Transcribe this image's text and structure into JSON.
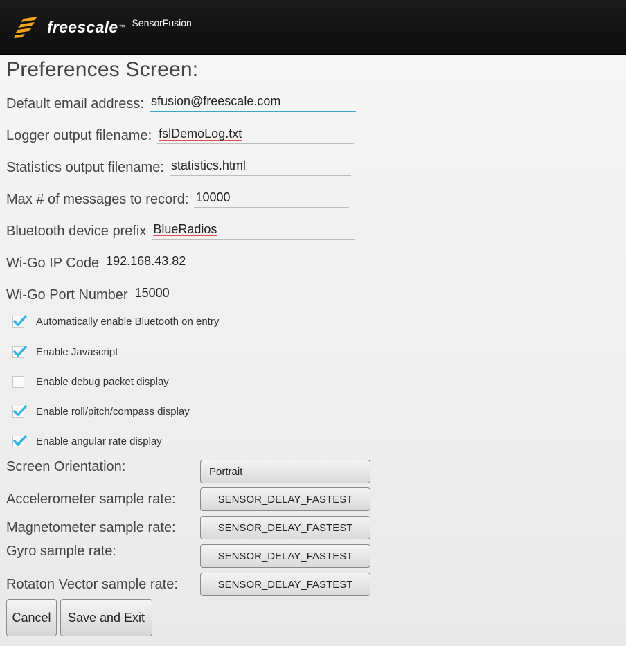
{
  "header": {
    "brand": "freescale",
    "trademark": "™",
    "app_name": "SensorFusion",
    "bar_color": "#111111",
    "logo_color": "#f2a51a"
  },
  "title": "Preferences Screen:",
  "fields": [
    {
      "label": "Default email address:",
      "value": "sfusion@freescale.com"
    },
    {
      "label": "Logger output filename:",
      "value": "fslDemoLog.txt"
    },
    {
      "label": "Statistics output filename:",
      "value": "statistics.html"
    },
    {
      "label": "Max # of messages to record:",
      "value": "10000"
    },
    {
      "label": "Bluetooth device prefix",
      "value": "BlueRadios"
    },
    {
      "label": "Wi-Go IP Code",
      "value": "192.168.43.82"
    },
    {
      "label": "Wi-Go Port Number",
      "value": "15000"
    }
  ],
  "checkboxes": [
    {
      "label": "Automatically enable Bluetooth on entry",
      "checked": true
    },
    {
      "label": "Enable Javascript",
      "checked": true
    },
    {
      "label": "Enable debug packet display",
      "checked": false
    },
    {
      "label": "Enable roll/pitch/compass display",
      "checked": true
    },
    {
      "label": "Enable angular rate display",
      "checked": true
    }
  ],
  "selects": [
    {
      "label": "Screen Orientation:",
      "value": "Portrait"
    },
    {
      "label": "Accelerometer sample rate:",
      "value": "SENSOR_DELAY_FASTEST"
    },
    {
      "label": "Magnetometer sample rate:",
      "value": "SENSOR_DELAY_FASTEST"
    },
    {
      "label": "Gyro sample rate:",
      "value": "SENSOR_DELAY_FASTEST"
    },
    {
      "label": "Rotaton Vector sample rate:",
      "value": "SENSOR_DELAY_FASTEST"
    }
  ],
  "buttons": {
    "cancel": "Cancel",
    "save": "Save and Exit"
  },
  "colors": {
    "focus_underline": "#3aa6c6",
    "check_color": "#33b5e5",
    "spell_underline": "#e24a4a"
  }
}
